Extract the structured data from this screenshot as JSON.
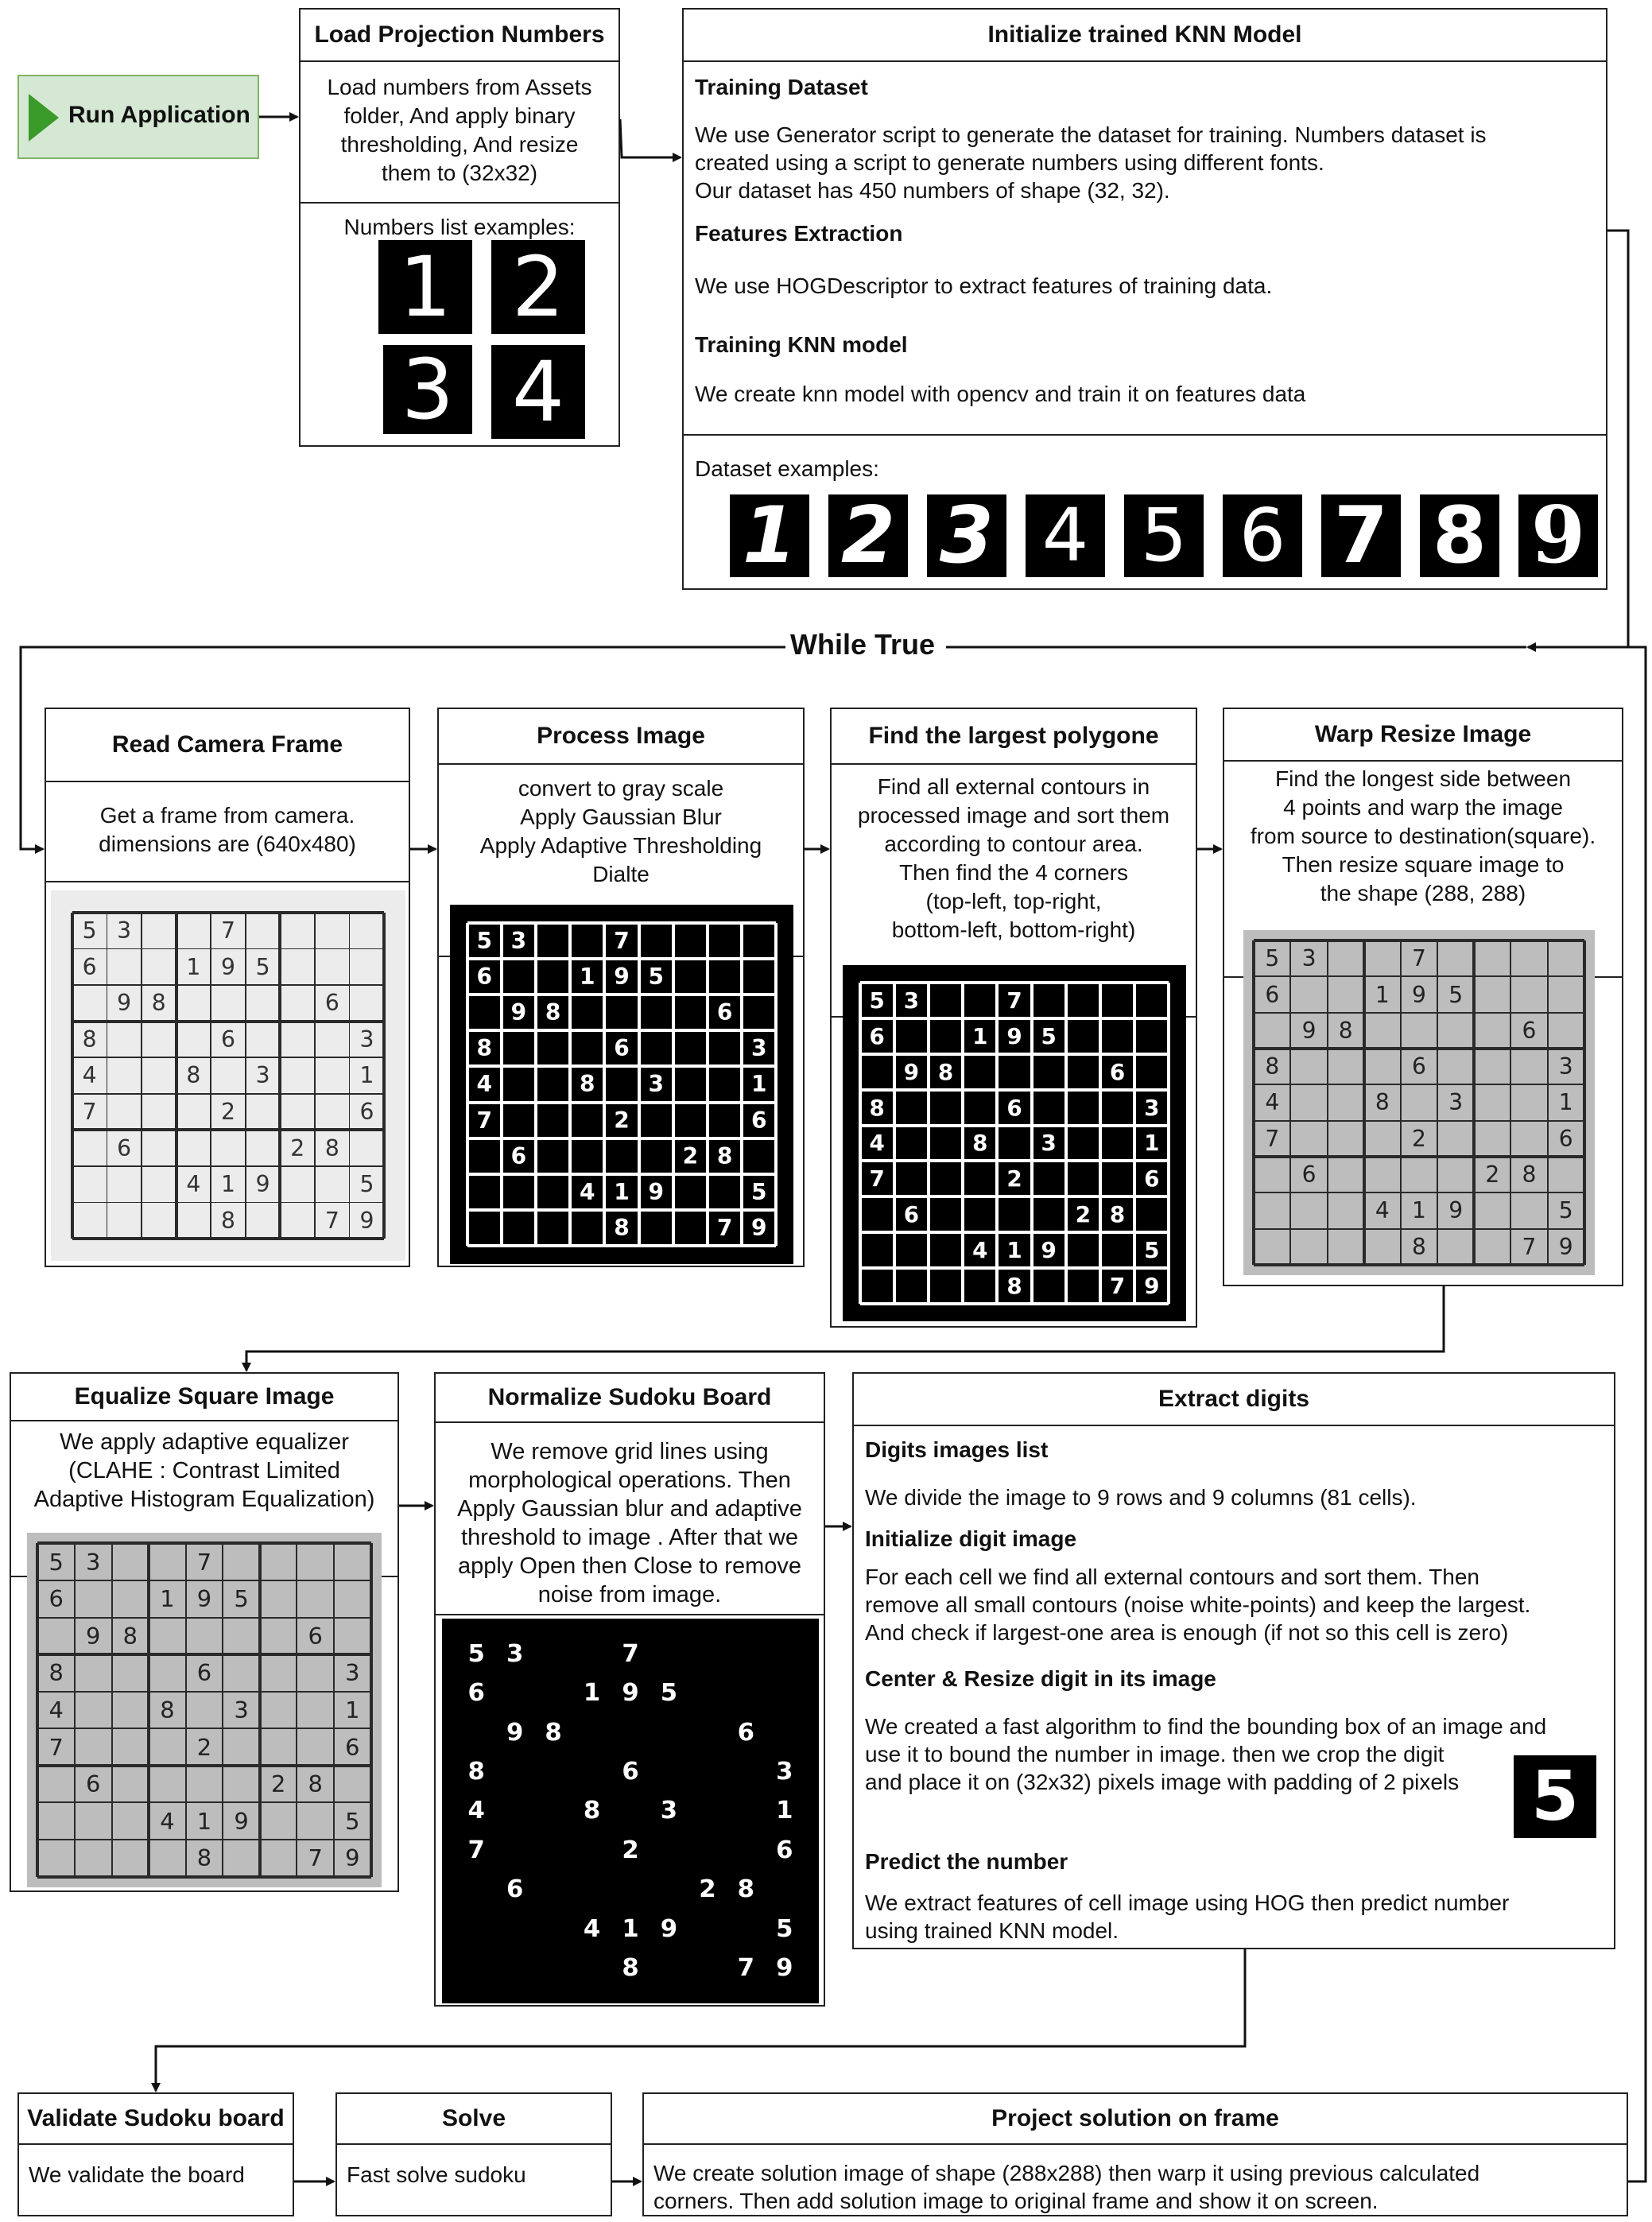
{
  "run_app": {
    "label": "Run Application",
    "color": "#d5e8d4",
    "play_color": "#3a9a2a"
  },
  "load": {
    "title": "Load Projection Numbers",
    "text": [
      "Load numbers from Assets",
      "folder, And apply binary",
      "thresholding, And resize",
      "them to (32x32)"
    ],
    "examples_label": "Numbers list examples:",
    "examples": [
      "1",
      "2",
      "3",
      "4"
    ]
  },
  "knn": {
    "title": "Initialize trained KNN Model",
    "sections": [
      {
        "title": "Training Dataset",
        "lines": [
          "We use Generator script to generate the dataset for training. Numbers dataset is",
          "created using a script to generate numbers using different fonts.",
          "Our dataset has 450 numbers of shape (32, 32)."
        ]
      },
      {
        "title": "Features Extraction",
        "lines": [
          "We use HOGDescriptor to extract features of training data."
        ]
      },
      {
        "title": "Training KNN model",
        "lines": [
          "We create knn model with opencv and train it on features data"
        ]
      }
    ],
    "examples_label": "Dataset examples:",
    "examples": [
      "1",
      "2",
      "3",
      "4",
      "5",
      "6",
      "7",
      "8",
      "9"
    ]
  },
  "loop_label": "While True",
  "read": {
    "title": "Read Camera Frame",
    "text": [
      "Get a frame from camera.",
      "dimensions are (640x480)"
    ]
  },
  "process": {
    "title": "Process Image",
    "text": [
      "convert to gray scale",
      "Apply Gaussian Blur",
      "Apply Adaptive Thresholding",
      "Dialte"
    ]
  },
  "polygon": {
    "title": "Find the largest polygone",
    "text": [
      "Find all external contours in",
      "processed image and sort them",
      "according to contour area.",
      "Then find the 4 corners",
      "(top-left, top-right,",
      "bottom-left, bottom-right)"
    ]
  },
  "warp": {
    "title": "Warp Resize Image",
    "text": [
      "Find the longest side between",
      "4 points and warp the image",
      "from source to destination(square).",
      "Then resize square image to",
      "the shape (288, 288)"
    ]
  },
  "equalize": {
    "title": "Equalize Square Image",
    "text": [
      "We apply adaptive equalizer",
      "(CLAHE : Contrast Limited",
      "Adaptive Histogram Equalization)"
    ]
  },
  "normalize": {
    "title": "Normalize Sudoku Board",
    "text": [
      "We remove grid lines using",
      "morphological operations. Then",
      "Apply Gaussian blur and adaptive",
      "threshold to image . After that we",
      "apply Open then Close to remove",
      "noise from image."
    ]
  },
  "extract": {
    "title": "Extract digits",
    "sections": [
      {
        "title": "Digits images list",
        "lines": [
          "We divide the image to 9 rows and 9 columns (81 cells)."
        ]
      },
      {
        "title": "Initialize digit image",
        "lines": [
          "For each cell we find all external contours and sort them. Then",
          "remove all small contours (noise white-points) and keep the largest.",
          "And check if largest-one area is enough (if not so this cell is zero)"
        ]
      },
      {
        "title": "Center & Resize digit in its image",
        "lines": [
          "We created a fast algorithm to find the bounding box of an image and",
          "use it to bound the number in image. then we crop the digit",
          "and place it on (32x32) pixels image with padding of 2 pixels"
        ]
      },
      {
        "title": "Predict the number",
        "lines": [
          "We extract features of cell image using HOG then predict number",
          "using trained KNN model."
        ]
      }
    ],
    "sample_digit": "5"
  },
  "validate": {
    "title": "Validate Sudoku board",
    "text": "We validate the board"
  },
  "solve": {
    "title": "Solve",
    "text": "Fast solve sudoku"
  },
  "project": {
    "title": "Project solution on frame",
    "text": [
      "We create solution image of shape (288x288) then warp it using previous calculated",
      "corners. Then add solution image to original frame and show it on screen."
    ]
  },
  "sudoku_grid": [
    [
      "5",
      "3",
      "",
      "",
      "7",
      "",
      "",
      "",
      ""
    ],
    [
      "6",
      "",
      "",
      "1",
      "9",
      "5",
      "",
      "",
      ""
    ],
    [
      "",
      "9",
      "8",
      "",
      "",
      "",
      "",
      "6",
      ""
    ],
    [
      "8",
      "",
      "",
      "",
      "6",
      "",
      "",
      "",
      "3"
    ],
    [
      "4",
      "",
      "",
      "8",
      "",
      "3",
      "",
      "",
      "1"
    ],
    [
      "7",
      "",
      "",
      "",
      "2",
      "",
      "",
      "",
      "6"
    ],
    [
      "",
      "6",
      "",
      "",
      "",
      "",
      "2",
      "8",
      ""
    ],
    [
      "",
      "",
      "",
      "4",
      "1",
      "9",
      "",
      "",
      "5"
    ],
    [
      "",
      "",
      "",
      "",
      "8",
      "",
      "",
      "7",
      "9"
    ]
  ]
}
